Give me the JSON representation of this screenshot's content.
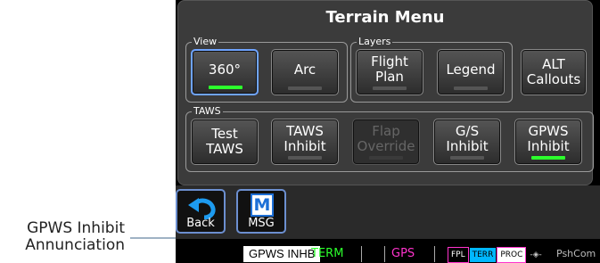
{
  "annotation": {
    "line1": "GPWS Inhibit",
    "line2": "Annunciation"
  },
  "menu": {
    "title": "Terrain Menu",
    "groups": {
      "view": "View",
      "layers": "Layers",
      "taws": "TAWS"
    },
    "buttons": {
      "view_360": {
        "label": "360°",
        "indicator": "on"
      },
      "arc": {
        "label": "Arc",
        "indicator": "off"
      },
      "flight_plan": {
        "label": "Flight\nPlan",
        "indicator": "off"
      },
      "legend": {
        "label": "Legend",
        "indicator": "off"
      },
      "alt_callouts": {
        "label": "ALT\nCallouts"
      },
      "test_taws": {
        "label": "Test\nTAWS"
      },
      "taws_inhibit": {
        "label": "TAWS\nInhibit",
        "indicator": "off"
      },
      "flap_override": {
        "label": "Flap\nOverride",
        "indicator": "off",
        "enabled": false
      },
      "gs_inhibit": {
        "label": "G/S\nInhibit",
        "indicator": "off"
      },
      "gpws_inhibit": {
        "label": "GPWS\nInhibit",
        "indicator": "on"
      }
    }
  },
  "softkeys": {
    "back": "Back",
    "msg": "MSG",
    "msg_icon_letter": "M"
  },
  "status_bar": {
    "gpws_inhb": "GPWS INHB",
    "term": "TERM",
    "gps": "GPS",
    "fpl": "FPL",
    "terr": "TERR",
    "proc": "PROC",
    "pshcom": "PshCom"
  },
  "colors": {
    "indicator_on": "#2cff2c",
    "active_border": "#6fa4ff",
    "term": "#2cff2c",
    "gps": "#ff33cc"
  }
}
